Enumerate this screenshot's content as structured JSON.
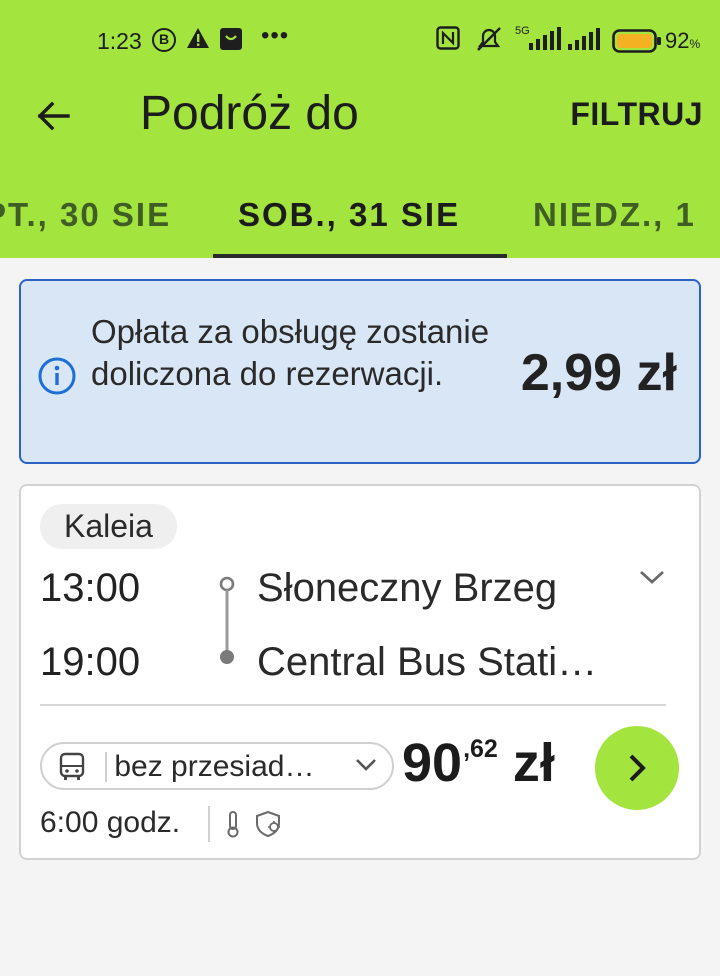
{
  "status_bar": {
    "time": "1:23",
    "notif_b": "B",
    "more": "•••",
    "battery_pct": "92",
    "battery_pct_suffix": "%",
    "network": "5G"
  },
  "appbar": {
    "title": "Podróż do",
    "filter_label": "FILTRUJ"
  },
  "date_tabs": [
    {
      "label": "PT., 30 SIE",
      "active": false
    },
    {
      "label": "SOB., 31 SIE",
      "active": true
    },
    {
      "label": "NIEDZ., 1",
      "active": false
    }
  ],
  "notice": {
    "text": "Opłata za obsługę zostanie doliczona do rezerwacji.",
    "fee": "2,99 zł"
  },
  "trip": {
    "operator": "Kaleia",
    "departure_time": "13:00",
    "arrival_time": "19:00",
    "departure_stop": "Słoneczny Brzeg",
    "arrival_stop": "Central Bus Stati…",
    "connection": "bez przesiad…",
    "price_main": "90",
    "price_cents": ",62",
    "price_currency": "zł",
    "duration": "6:00 godz."
  },
  "colors": {
    "brand_green": "#a4e43f",
    "notice_bg": "#d9e6f5",
    "notice_border": "#2a63c3",
    "info_blue": "#1c6fd4"
  },
  "icons": [
    "back-arrow-icon",
    "filter",
    "info-icon",
    "chevron-down-icon",
    "bus-icon",
    "chevron-right-icon",
    "thermometer-icon",
    "virus-shield-icon"
  ]
}
